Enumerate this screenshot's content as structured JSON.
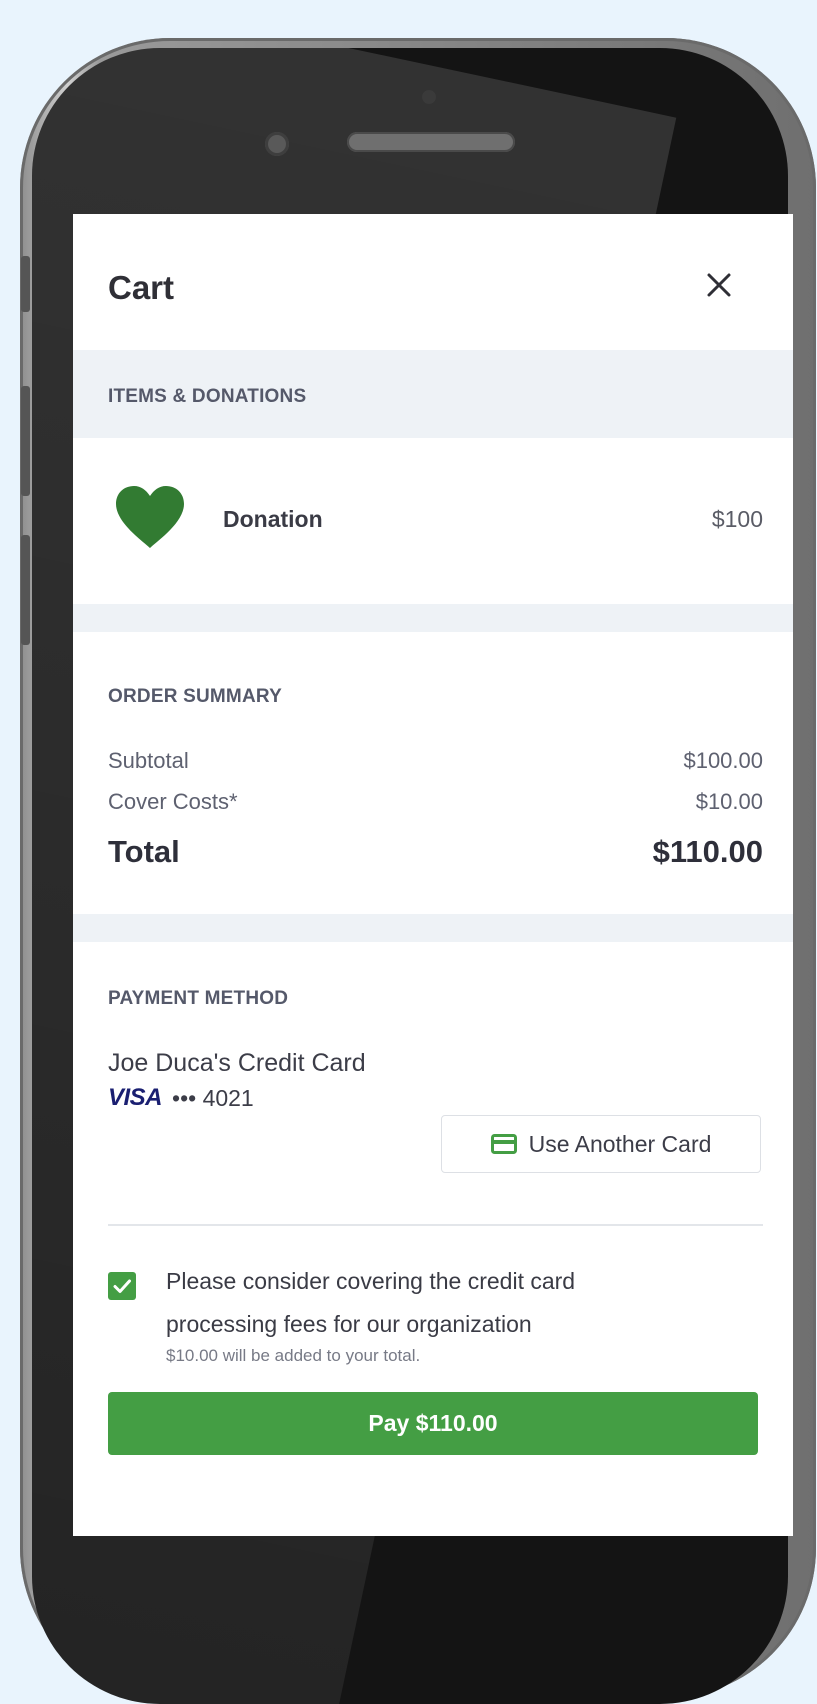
{
  "cart": {
    "title": "Cart",
    "close_icon": "close-icon"
  },
  "items_section": {
    "label": "ITEMS & DONATIONS",
    "items": [
      {
        "icon": "heart-icon",
        "name": "Donation",
        "price": "$100",
        "icon_color": "#327b32"
      }
    ]
  },
  "order_summary": {
    "label": "ORDER SUMMARY",
    "rows": [
      {
        "label": "Subtotal",
        "value": "$100.00"
      },
      {
        "label": "Cover Costs*",
        "value": "$10.00"
      }
    ],
    "total_label": "Total",
    "total_value": "$110.00"
  },
  "payment": {
    "label": "PAYMENT METHOD",
    "card_name": "Joe Duca's Credit Card",
    "card_brand": "VISA",
    "card_masked": "••• 4021",
    "another_card_label": "Use Another Card",
    "another_card_icon": "credit-card-icon"
  },
  "consent": {
    "checked": true,
    "text": "Please consider covering the credit card processing fees for our organization",
    "note": "$10.00 will be added to your total."
  },
  "pay_button": {
    "label": "Pay $110.00"
  },
  "colors": {
    "accent": "#449e44",
    "heart": "#327b32",
    "section_bg": "#eef2f6",
    "visa": "#1a1f71"
  }
}
